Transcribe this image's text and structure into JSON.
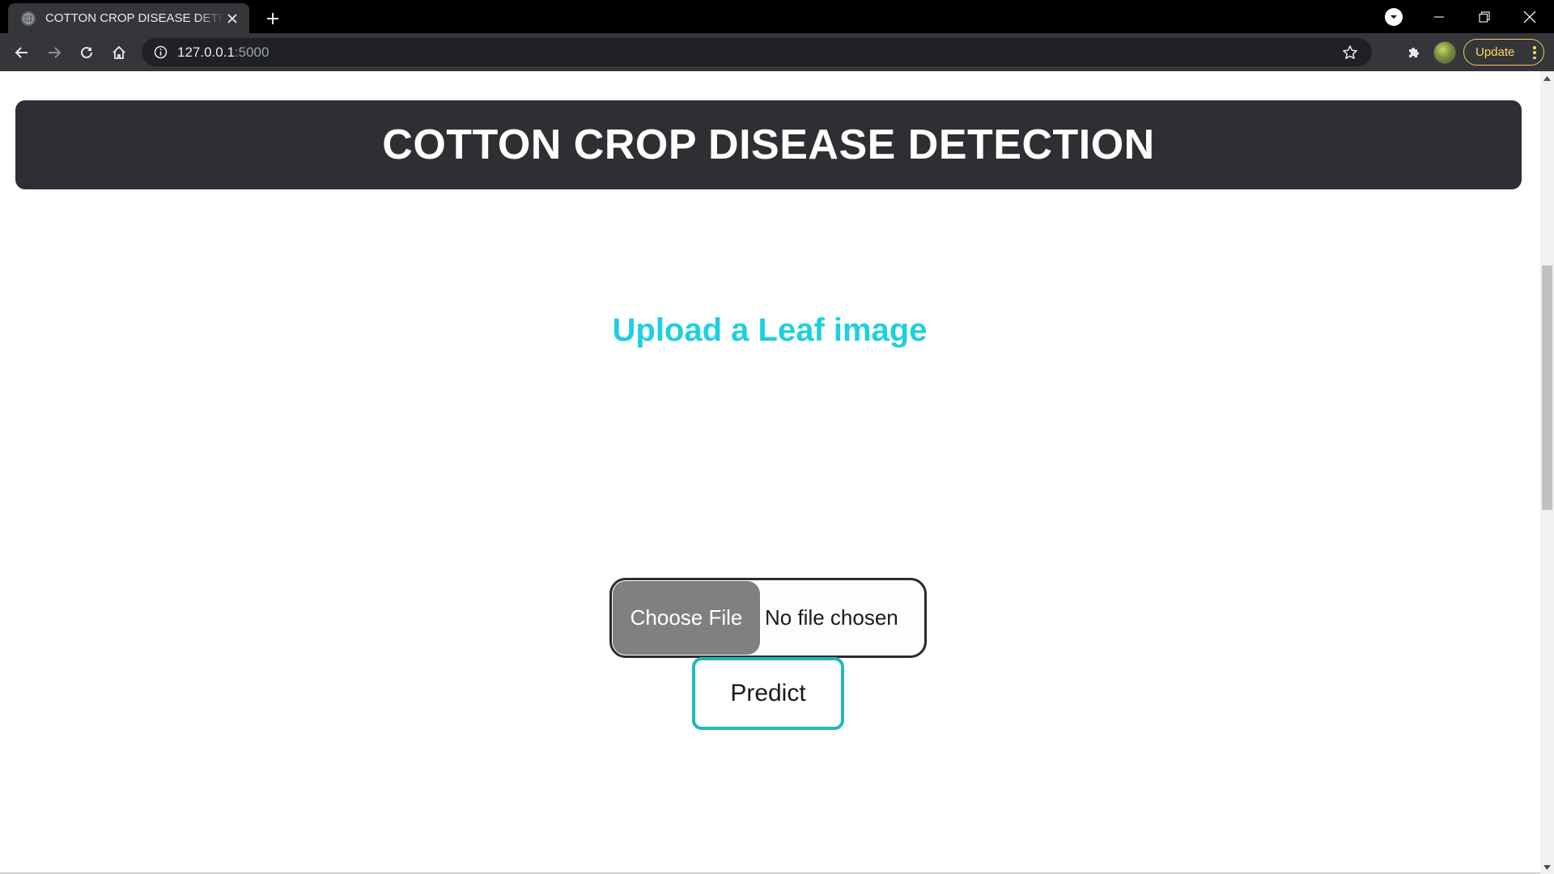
{
  "browser": {
    "tab_title": "COTTON CROP DISEASE DETECTION",
    "url_host": "127.0.0.1",
    "url_port": ":5000",
    "update_label": "Update"
  },
  "page": {
    "header_title": "COTTON CROP DISEASE DETECTION",
    "upload_heading": "Upload a Leaf image",
    "file_input": {
      "button_label": "Choose File",
      "status": "No file chosen"
    },
    "predict_label": "Predict"
  },
  "colors": {
    "header_bg": "#2d2f32",
    "heading_accent": "#1fcfe0",
    "predict_border": "#22b8b8",
    "choose_button_bg": "#808080"
  }
}
